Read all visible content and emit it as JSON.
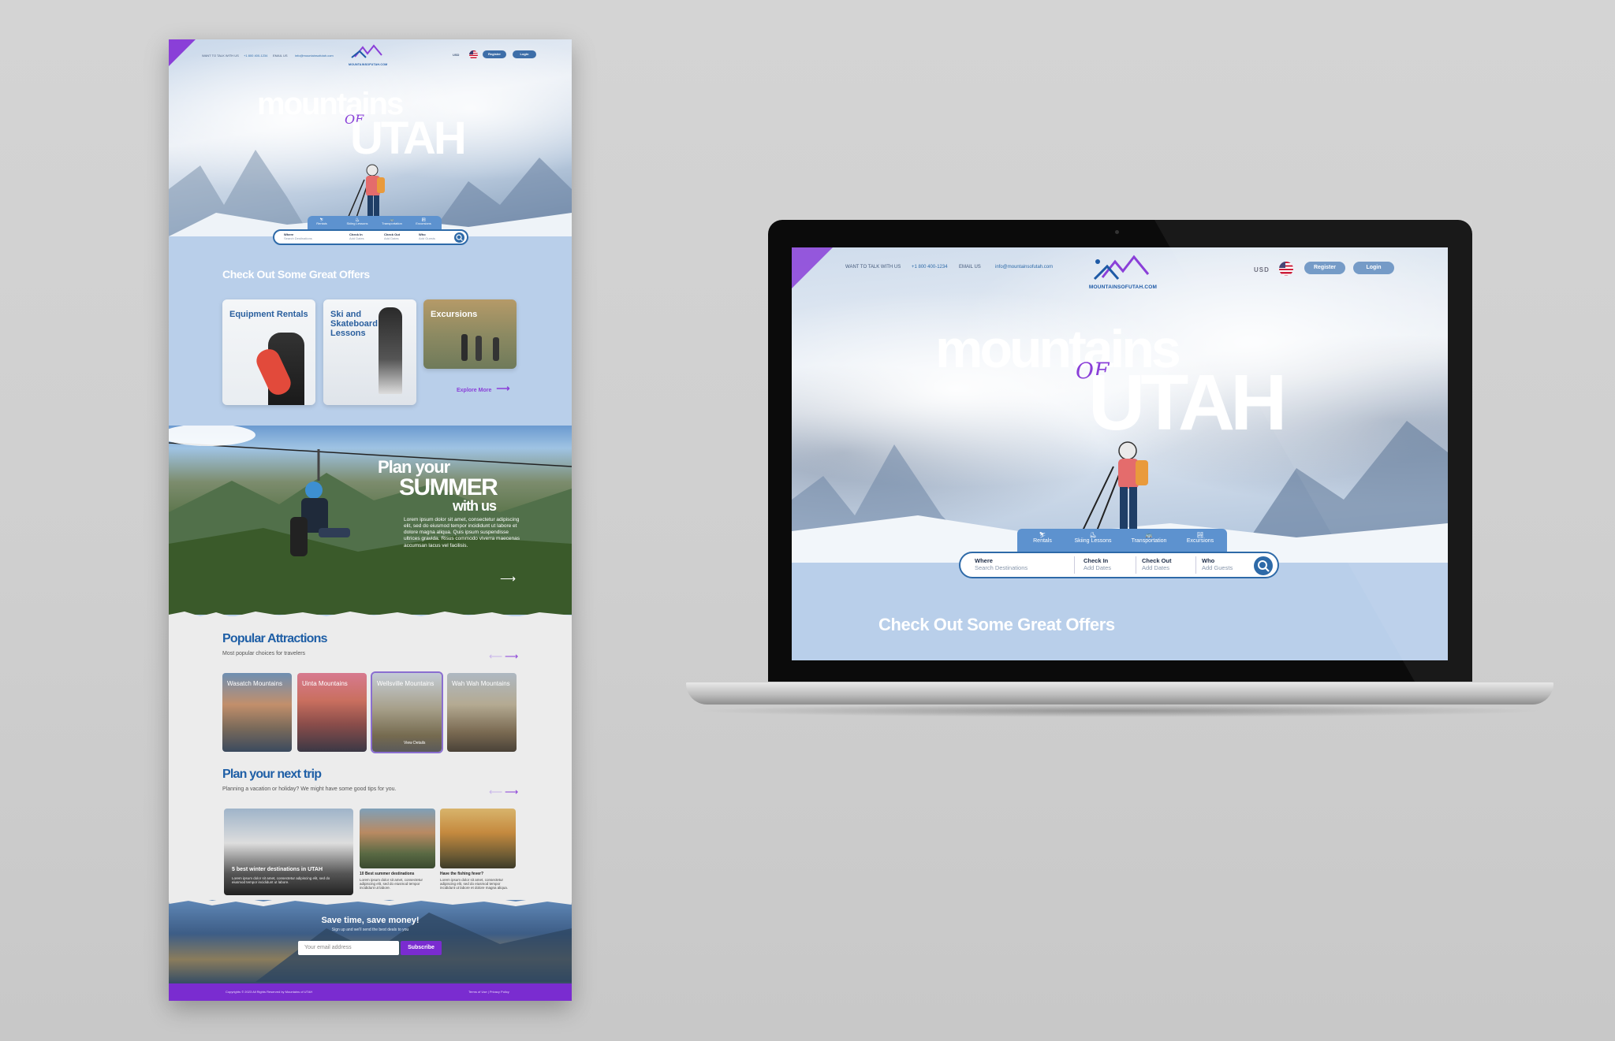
{
  "topbar": {
    "want_to_talk": "WANT TO TALK WITH US",
    "phone": "+1 800 400-1234",
    "email_label": "EMAIL US",
    "email": "info@mountainsofutah.com",
    "currency": "USD",
    "register": "Register",
    "login": "Login",
    "logo_text": "MOUNTAINSOFUTAH.COM"
  },
  "hero": {
    "word1": "mountains",
    "word_of": "OF",
    "word2": "UTAH"
  },
  "tabs": [
    "Rentals",
    "Skiing Lessons",
    "Transportation",
    "Excursions"
  ],
  "search": {
    "where_label": "Where",
    "where_placeholder": "Search Destinations",
    "checkin_label": "Check In",
    "checkin_placeholder": "Add Dates",
    "checkout_label": "Check Out",
    "checkout_placeholder": "Add Dates",
    "who_label": "Who",
    "who_placeholder": "Add Guests"
  },
  "offers": {
    "heading": "Check Out Some Great Offers",
    "cards": [
      "Equipment Rentals",
      "Ski and Skateboard Lessons",
      "Excursions"
    ],
    "explore": "Explore More"
  },
  "summer": {
    "line1": "Plan your",
    "line2": "SUMMER",
    "line3": "with us",
    "body": "Lorem ipsum dolor sit amet, consectetur adipiscing elit, sed do eiusmod tempor incididunt ut labore et dolore magna aliqua. Quis ipsum suspendisse ultrices gravida. Risus commodo viverra maecenas accumsan lacus vel facilisis."
  },
  "attractions": {
    "heading": "Popular Attractions",
    "sub": "Most popular choices for travelers",
    "cards": [
      "Wasatch Mountains",
      "Uinta Mountains",
      "Wellsville Mountains",
      "Wah Wah Mountains"
    ],
    "view_details": "View Details"
  },
  "trip": {
    "heading": "Plan your next trip",
    "sub": "Planning a vacation or holiday? We might have some good tips for you.",
    "cards": [
      {
        "title": "5 best winter destinations in UTAH",
        "text": "Lorem ipsum dolor sit amet, consectetur adipiscing elit, sed do eiusmod tempor incididunt ut labore."
      },
      {
        "title": "10 Best summer destinations",
        "text": "Lorem ipsum dolor sit amet, consectetur adipiscing elit, sed do eiusmod tempor incididunt ut labore."
      },
      {
        "title": "Have the fishing fever?",
        "text": "Lorem ipsum dolor sit amet, consectetur adipiscing elit, sed do eiusmod tempor incididunt ut labore et dolore magna aliqua."
      }
    ]
  },
  "newsletter": {
    "heading": "Save time, save money!",
    "sub": "Sign up and we'll send the best deals to you",
    "placeholder": "Your email address",
    "button": "Subscribe"
  },
  "footer": {
    "copyright": "Copyrights © 2023 All Rights Reserved by Mountains of UTAH",
    "links": "Terms of Use | Privacy Policy"
  },
  "colors": {
    "accent_purple": "#8a3fd8",
    "brand_blue": "#2e6aa8",
    "page_bg": "#b9cfea"
  },
  "icons": [
    "flag-us-icon",
    "search-icon",
    "arrow-right-icon",
    "arrow-left-icon",
    "rental-icon",
    "skiing-icon",
    "transport-icon",
    "excursion-icon"
  ]
}
